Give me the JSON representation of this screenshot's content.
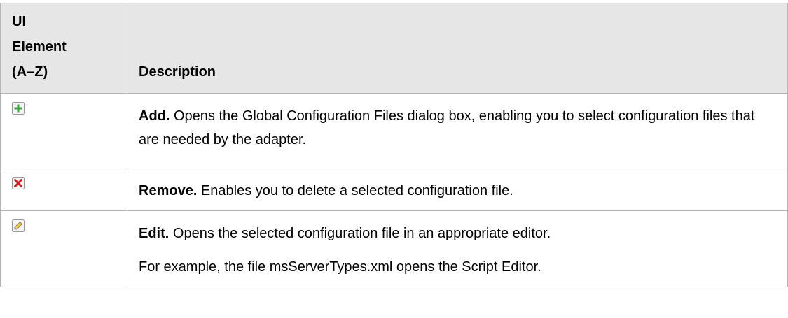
{
  "table": {
    "header": {
      "col1": "UI Element (A–Z)",
      "col1_line1": "UI",
      "col1_line2": "Element",
      "col1_line3": "(A–Z)",
      "col2": "Description"
    },
    "rows": [
      {
        "icon": "add-icon",
        "term": "Add.",
        "text": " Opens the Global Configuration Files dialog box, enabling you to select configuration files that are needed by the adapter."
      },
      {
        "icon": "remove-icon",
        "term": "Remove.",
        "text": " Enables you to delete a selected configuration file."
      },
      {
        "icon": "edit-icon",
        "term": "Edit.",
        "text": " Opens the selected configuration file in an appropriate editor.",
        "extra": "For example, the file msServerTypes.xml opens the Script Editor."
      }
    ]
  },
  "colors": {
    "header_bg": "#e6e6e6",
    "border": "#b4b4b4",
    "add_green": "#3ca03c",
    "remove_red": "#d42020"
  }
}
